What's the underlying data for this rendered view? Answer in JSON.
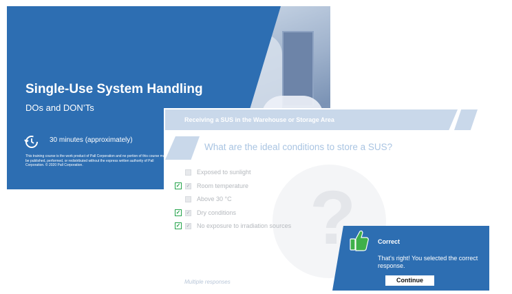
{
  "title_slide": {
    "title": "Single-Use System Handling",
    "subtitle": "DOs and DON’Ts",
    "duration": "30 minutes (approximately)",
    "legal_text": "This training course is the work product of Pall Corporation and no portion of this course may be published, performed, or redistributed without the express written authority of Pall Corporation. © 2020 Pall Corporation.",
    "icon": "stopwatch-icon"
  },
  "question_slide": {
    "header": "Receiving a SUS in the Warehouse or Storage Area",
    "question": "What are the ideal conditions to store a SUS?",
    "options": [
      {
        "label": "Exposed to sunlight",
        "correct": false,
        "checked": false
      },
      {
        "label": "Room temperature",
        "correct": true,
        "checked": true
      },
      {
        "label": "Above 30 °C",
        "correct": false,
        "checked": false
      },
      {
        "label": "Dry conditions",
        "correct": true,
        "checked": true
      },
      {
        "label": "No exposure to irradiation sources",
        "correct": true,
        "checked": true
      }
    ],
    "note": "Multiple responses",
    "background_glyph": "?"
  },
  "feedback": {
    "title": "Correct",
    "message": "That's right! You selected the correct response.",
    "button_label": "Continue",
    "icon": "thumbs-up-icon"
  },
  "colors": {
    "brand_blue": "#2d6eb2",
    "header_tint": "#c9d8ea",
    "correct_green": "#23a34a"
  }
}
